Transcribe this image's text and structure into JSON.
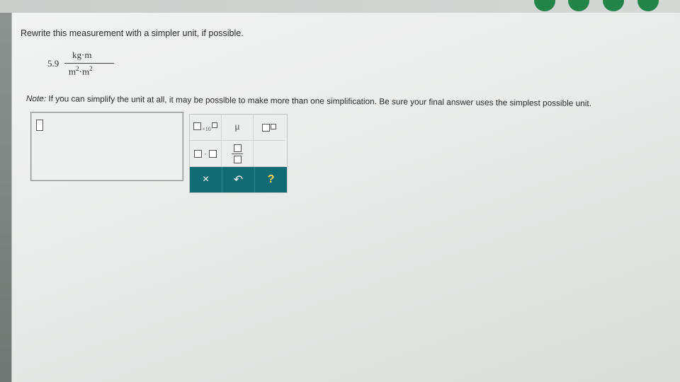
{
  "question": "Rewrite this measurement with a simpler unit, if possible.",
  "expression": {
    "coefficient": "5.9",
    "numerator": "kg·m",
    "denominator_base1": "m",
    "denominator_exp1": "2",
    "denominator_dot": "·",
    "denominator_base2": "m",
    "denominator_exp2": "2"
  },
  "note": {
    "label": "Note:",
    "text": "If you can simplify the unit at all, it may be possible to make more than one simplification. Be sure your final answer uses the simplest possible unit."
  },
  "toolbar": {
    "sci_text": "×10",
    "mu": "μ",
    "dot": "·",
    "clear": "×",
    "undo": "↶",
    "help": "?"
  },
  "colors": {
    "action_bg": "#116b74",
    "top_dots": "#23844a"
  }
}
